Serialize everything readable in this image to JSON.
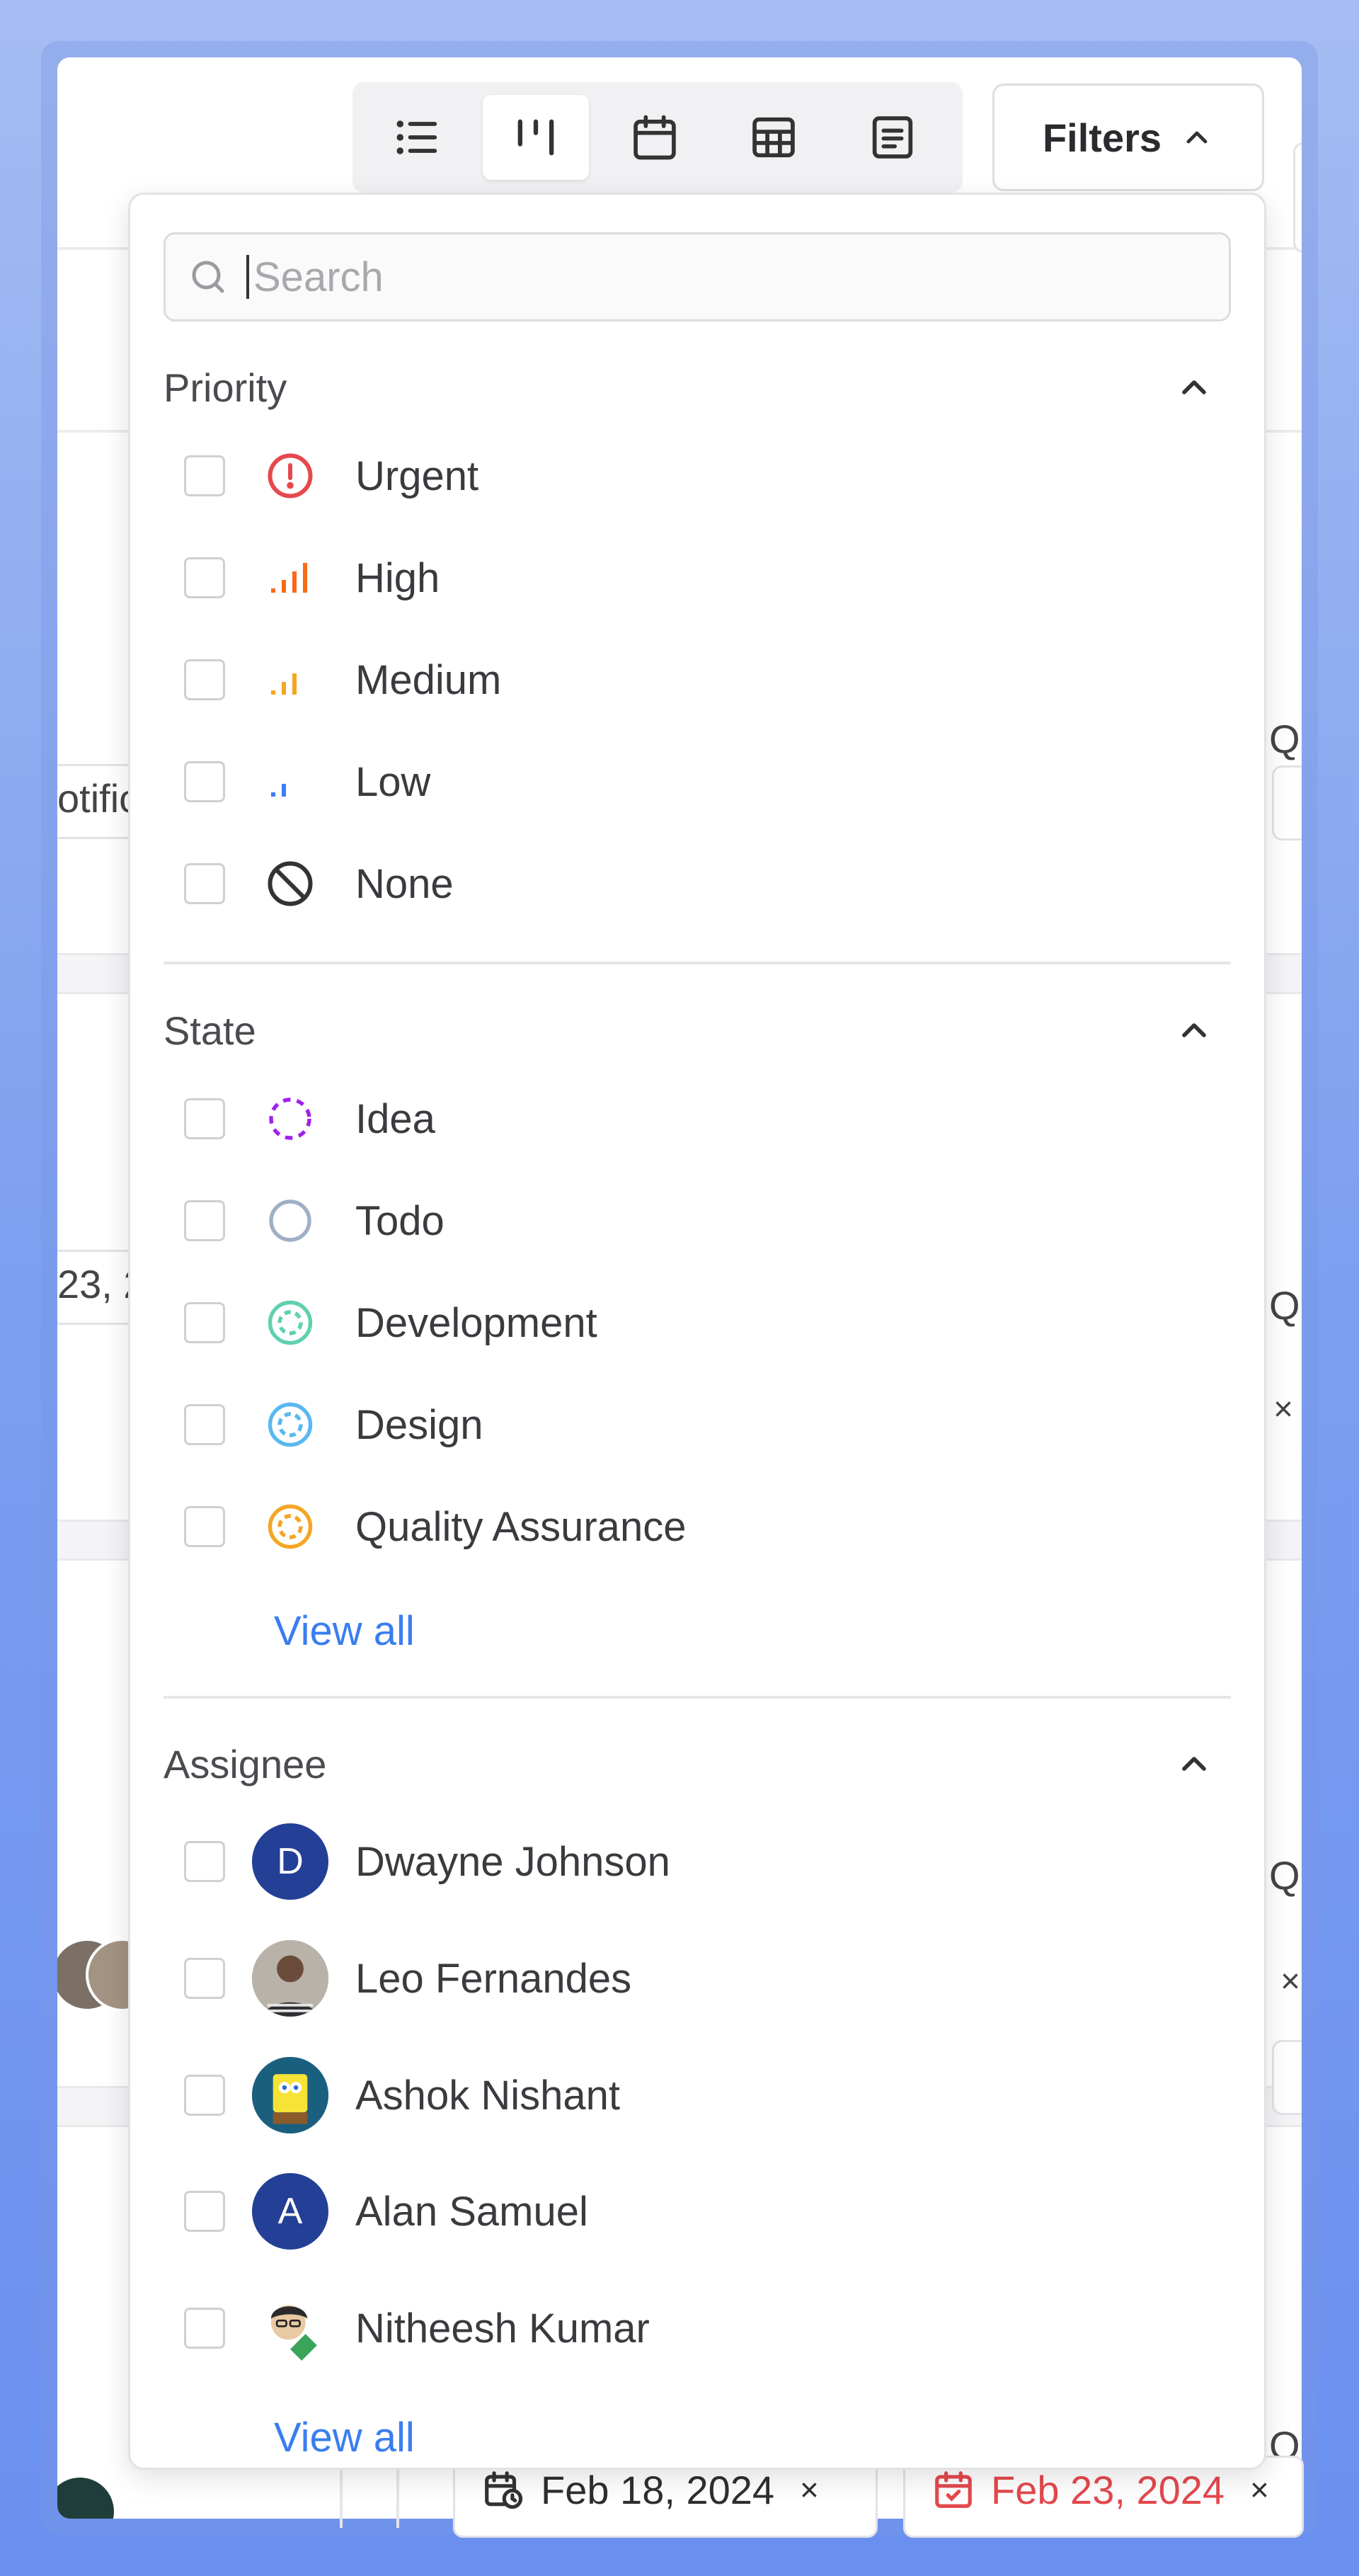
{
  "toolbar": {
    "views": [
      {
        "name": "list-view",
        "icon": "list-icon",
        "active": false
      },
      {
        "name": "board-view",
        "icon": "board-icon",
        "active": true
      },
      {
        "name": "calendar-view",
        "icon": "calendar-icon",
        "active": false
      },
      {
        "name": "table-view",
        "icon": "table-icon",
        "active": false
      },
      {
        "name": "gantt-view",
        "icon": "gantt-icon",
        "active": false
      }
    ],
    "filters_label": "Filters"
  },
  "filters": {
    "search_placeholder": "Search",
    "priority": {
      "title": "Priority",
      "options": [
        {
          "label": "Urgent",
          "color": "#e5484d"
        },
        {
          "label": "High",
          "color": "#f76b15"
        },
        {
          "label": "Medium",
          "color": "#f5a524"
        },
        {
          "label": "Low",
          "color": "#3e7bf6"
        },
        {
          "label": "None",
          "color": "#333333"
        }
      ]
    },
    "state": {
      "title": "State",
      "options": [
        {
          "label": "Idea",
          "color": "#a020f0"
        },
        {
          "label": "Todo",
          "color": "#9fb0c4"
        },
        {
          "label": "Development",
          "color": "#5fd0b0"
        },
        {
          "label": "Design",
          "color": "#5ab8f0"
        },
        {
          "label": "Quality Assurance",
          "color": "#f5a524"
        }
      ],
      "view_all": "View all"
    },
    "assignee": {
      "title": "Assignee",
      "options": [
        {
          "label": "Dwayne Johnson",
          "initial": "D",
          "avatar_color": "#233f96"
        },
        {
          "label": "Leo Fernandes",
          "initial": "",
          "avatar_color": "#8a8f96"
        },
        {
          "label": "Ashok Nishant",
          "initial": "",
          "avatar_color": "#1f6b8a"
        },
        {
          "label": "Alan Samuel",
          "initial": "A",
          "avatar_color": "#233f96"
        },
        {
          "label": "Nitheesh Kumar",
          "initial": "",
          "avatar_color": "#ffffff"
        }
      ],
      "view_all": "View all"
    }
  },
  "background": {
    "frag_notific": "otific",
    "frag_date": "23, 2",
    "frag_q": "Q",
    "frag_x": "×",
    "start_date": "Feb 18, 2024",
    "due_date": "Feb 23, 2024",
    "due_color": "#e5484d"
  }
}
